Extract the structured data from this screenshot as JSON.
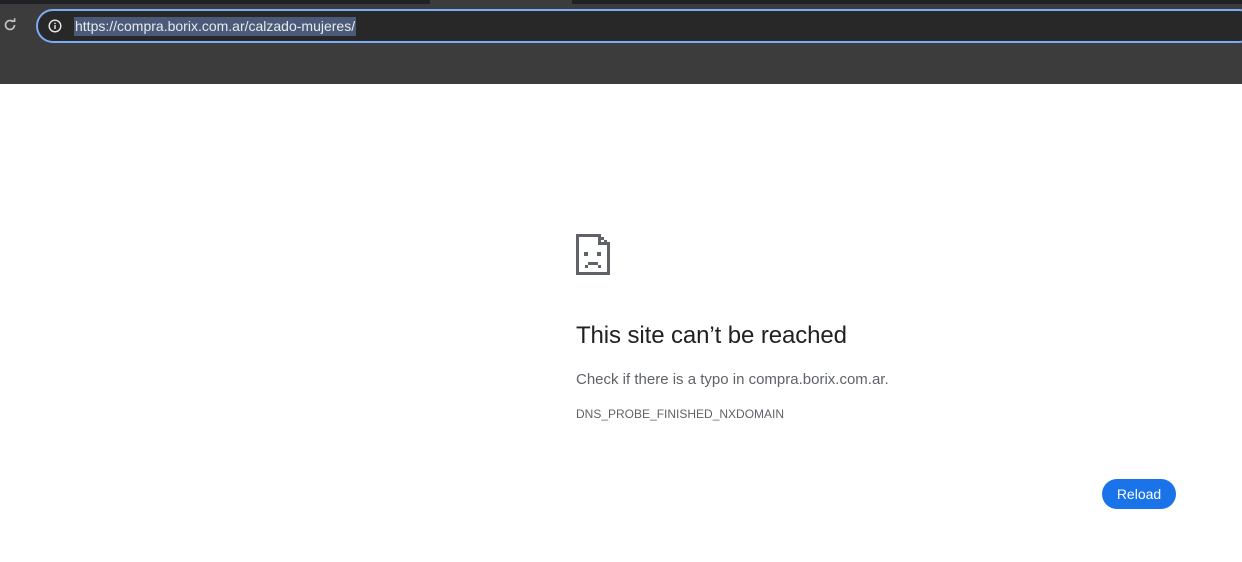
{
  "browser": {
    "url": "https://compra.borix.com.ar/calzado-mujeres/",
    "icons": {
      "reload": "reload-icon",
      "site_info": "info-icon"
    }
  },
  "error_page": {
    "icon": "sad-document-icon",
    "title": "This site can’t be reached",
    "description": "Check if there is a typo in compra.borix.com.ar.",
    "error_code": "DNS_PROBE_FINISHED_NXDOMAIN",
    "reload_label": "Reload"
  },
  "colors": {
    "chrome_background": "#3c3c3c",
    "omnibox_focus_ring": "#7cacf8",
    "url_selection": "#4a5a78",
    "reload_button": "#1a73e8",
    "title_text": "#202124",
    "secondary_text": "#5f6368"
  }
}
